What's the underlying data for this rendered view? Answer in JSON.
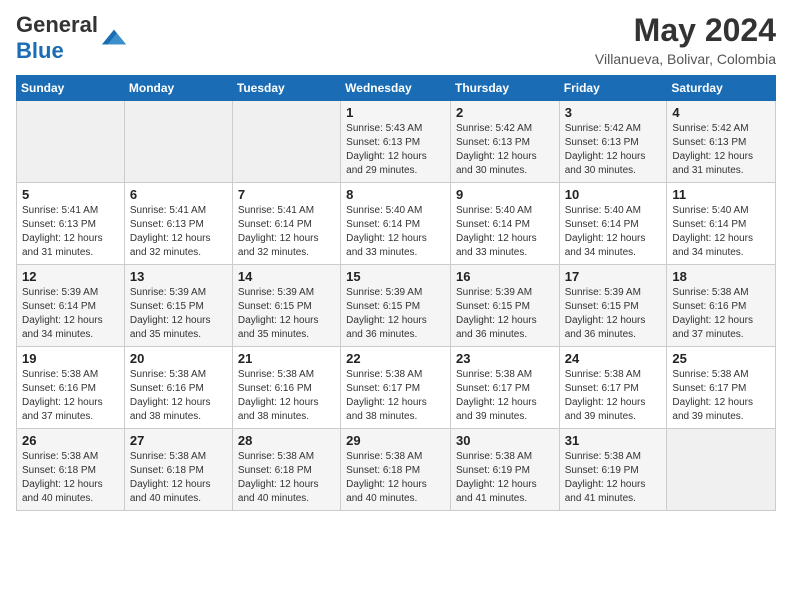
{
  "header": {
    "monthYear": "May 2024",
    "location": "Villanueva, Bolivar, Colombia"
  },
  "days": [
    "Sunday",
    "Monday",
    "Tuesday",
    "Wednesday",
    "Thursday",
    "Friday",
    "Saturday"
  ],
  "weeks": [
    [
      {
        "day": "",
        "info": ""
      },
      {
        "day": "",
        "info": ""
      },
      {
        "day": "",
        "info": ""
      },
      {
        "day": "1",
        "info": "Sunrise: 5:43 AM\nSunset: 6:13 PM\nDaylight: 12 hours\nand 29 minutes."
      },
      {
        "day": "2",
        "info": "Sunrise: 5:42 AM\nSunset: 6:13 PM\nDaylight: 12 hours\nand 30 minutes."
      },
      {
        "day": "3",
        "info": "Sunrise: 5:42 AM\nSunset: 6:13 PM\nDaylight: 12 hours\nand 30 minutes."
      },
      {
        "day": "4",
        "info": "Sunrise: 5:42 AM\nSunset: 6:13 PM\nDaylight: 12 hours\nand 31 minutes."
      }
    ],
    [
      {
        "day": "5",
        "info": "Sunrise: 5:41 AM\nSunset: 6:13 PM\nDaylight: 12 hours\nand 31 minutes."
      },
      {
        "day": "6",
        "info": "Sunrise: 5:41 AM\nSunset: 6:13 PM\nDaylight: 12 hours\nand 32 minutes."
      },
      {
        "day": "7",
        "info": "Sunrise: 5:41 AM\nSunset: 6:14 PM\nDaylight: 12 hours\nand 32 minutes."
      },
      {
        "day": "8",
        "info": "Sunrise: 5:40 AM\nSunset: 6:14 PM\nDaylight: 12 hours\nand 33 minutes."
      },
      {
        "day": "9",
        "info": "Sunrise: 5:40 AM\nSunset: 6:14 PM\nDaylight: 12 hours\nand 33 minutes."
      },
      {
        "day": "10",
        "info": "Sunrise: 5:40 AM\nSunset: 6:14 PM\nDaylight: 12 hours\nand 34 minutes."
      },
      {
        "day": "11",
        "info": "Sunrise: 5:40 AM\nSunset: 6:14 PM\nDaylight: 12 hours\nand 34 minutes."
      }
    ],
    [
      {
        "day": "12",
        "info": "Sunrise: 5:39 AM\nSunset: 6:14 PM\nDaylight: 12 hours\nand 34 minutes."
      },
      {
        "day": "13",
        "info": "Sunrise: 5:39 AM\nSunset: 6:15 PM\nDaylight: 12 hours\nand 35 minutes."
      },
      {
        "day": "14",
        "info": "Sunrise: 5:39 AM\nSunset: 6:15 PM\nDaylight: 12 hours\nand 35 minutes."
      },
      {
        "day": "15",
        "info": "Sunrise: 5:39 AM\nSunset: 6:15 PM\nDaylight: 12 hours\nand 36 minutes."
      },
      {
        "day": "16",
        "info": "Sunrise: 5:39 AM\nSunset: 6:15 PM\nDaylight: 12 hours\nand 36 minutes."
      },
      {
        "day": "17",
        "info": "Sunrise: 5:39 AM\nSunset: 6:15 PM\nDaylight: 12 hours\nand 36 minutes."
      },
      {
        "day": "18",
        "info": "Sunrise: 5:38 AM\nSunset: 6:16 PM\nDaylight: 12 hours\nand 37 minutes."
      }
    ],
    [
      {
        "day": "19",
        "info": "Sunrise: 5:38 AM\nSunset: 6:16 PM\nDaylight: 12 hours\nand 37 minutes."
      },
      {
        "day": "20",
        "info": "Sunrise: 5:38 AM\nSunset: 6:16 PM\nDaylight: 12 hours\nand 38 minutes."
      },
      {
        "day": "21",
        "info": "Sunrise: 5:38 AM\nSunset: 6:16 PM\nDaylight: 12 hours\nand 38 minutes."
      },
      {
        "day": "22",
        "info": "Sunrise: 5:38 AM\nSunset: 6:17 PM\nDaylight: 12 hours\nand 38 minutes."
      },
      {
        "day": "23",
        "info": "Sunrise: 5:38 AM\nSunset: 6:17 PM\nDaylight: 12 hours\nand 39 minutes."
      },
      {
        "day": "24",
        "info": "Sunrise: 5:38 AM\nSunset: 6:17 PM\nDaylight: 12 hours\nand 39 minutes."
      },
      {
        "day": "25",
        "info": "Sunrise: 5:38 AM\nSunset: 6:17 PM\nDaylight: 12 hours\nand 39 minutes."
      }
    ],
    [
      {
        "day": "26",
        "info": "Sunrise: 5:38 AM\nSunset: 6:18 PM\nDaylight: 12 hours\nand 40 minutes."
      },
      {
        "day": "27",
        "info": "Sunrise: 5:38 AM\nSunset: 6:18 PM\nDaylight: 12 hours\nand 40 minutes."
      },
      {
        "day": "28",
        "info": "Sunrise: 5:38 AM\nSunset: 6:18 PM\nDaylight: 12 hours\nand 40 minutes."
      },
      {
        "day": "29",
        "info": "Sunrise: 5:38 AM\nSunset: 6:18 PM\nDaylight: 12 hours\nand 40 minutes."
      },
      {
        "day": "30",
        "info": "Sunrise: 5:38 AM\nSunset: 6:19 PM\nDaylight: 12 hours\nand 41 minutes."
      },
      {
        "day": "31",
        "info": "Sunrise: 5:38 AM\nSunset: 6:19 PM\nDaylight: 12 hours\nand 41 minutes."
      },
      {
        "day": "",
        "info": ""
      }
    ]
  ]
}
